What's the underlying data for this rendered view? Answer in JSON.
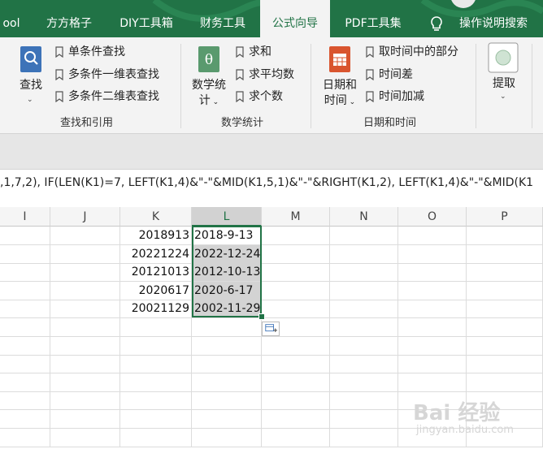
{
  "tabs": [
    {
      "label": "ool",
      "active": false
    },
    {
      "label": "方方格子",
      "active": false
    },
    {
      "label": "DIY工具箱",
      "active": false
    },
    {
      "label": "财务工具",
      "active": false
    },
    {
      "label": "公式向导",
      "active": true
    },
    {
      "label": "PDF工具集",
      "active": false
    },
    {
      "label": "操作说明搜索",
      "active": false,
      "icon": "lightbulb-icon"
    }
  ],
  "ribbon": {
    "find": {
      "big_label": "查找",
      "big_icon": "search-icon",
      "items": [
        "单条件查找",
        "多条件一维表查找",
        "多条件二维表查找"
      ],
      "group_label": "查找和引用"
    },
    "math": {
      "big_label_line1": "数学统",
      "big_label_line2": "计",
      "big_icon": "theta-icon",
      "items": [
        "求和",
        "求平均数",
        "求个数"
      ],
      "group_label": "数学统计"
    },
    "date": {
      "big_label_line1": "日期和",
      "big_label_line2": "时间",
      "big_icon": "calendar-icon",
      "items": [
        "取时间中的部分",
        "时间差",
        "时间加减"
      ],
      "group_label": "日期和时间"
    },
    "extract": {
      "big_label": "提取",
      "big_icon": "extract-icon"
    }
  },
  "formula_bar": {
    "text": ",1,7,2), IF(LEN(K1)=7, LEFT(K1,4)&\"-\"&MID(K1,5,1)&\"-\"&RIGHT(K1,2),  LEFT(K1,4)&\"-\"&MID(K1"
  },
  "columns": [
    "I",
    "J",
    "K",
    "L",
    "M",
    "N",
    "O",
    "P"
  ],
  "selected_column": "L",
  "rows": [
    {
      "K": "2018913",
      "L": "2018-9-13"
    },
    {
      "K": "20221224",
      "L": "2022-12-24"
    },
    {
      "K": "20121013",
      "L": "2012-10-13"
    },
    {
      "K": "2020617",
      "L": "2020-6-17"
    },
    {
      "K": "20021129",
      "L": "2002-11-29"
    }
  ],
  "watermark": {
    "main": "Bai 经验",
    "sub": "jingyan.baidu.com"
  },
  "colors": {
    "accent": "#217346",
    "selection_fill": "#d3d3d3"
  }
}
